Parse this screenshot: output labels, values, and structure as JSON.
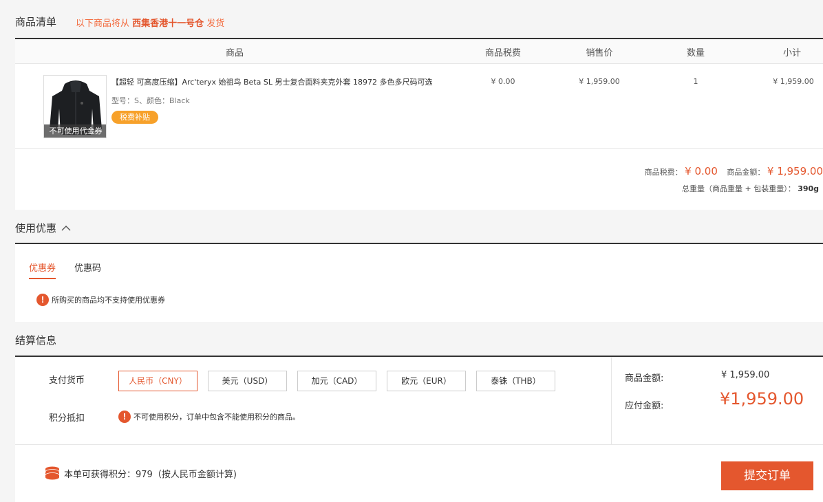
{
  "goods": {
    "title": "商品清单",
    "ship_prefix": "以下商品将从",
    "warehouse": "西集香港十一号仓",
    "ship_suffix": "发货",
    "headers": {
      "product": "商品",
      "tax": "商品税费",
      "price": "销售价",
      "qty": "数量",
      "subtotal": "小计"
    },
    "item": {
      "name": "【超轻 可高度压缩】Arc'teryx 始祖鸟 Beta SL 男士复合面料夹克外套 18972 多色多尺码可选",
      "spec": "型号：S、颜色：Black",
      "badge": "税费补贴",
      "image_label": "不可使用代金券",
      "tax": "¥ 0.00",
      "price": "¥ 1,959.00",
      "qty": "1",
      "subtotal": "¥ 1,959.00"
    },
    "summary": {
      "tax_label": "商品税费：",
      "tax_value": "¥ 0.00",
      "amount_label": "商品金额：",
      "amount_value": "¥ 1,959.00",
      "weight_label": "总重量（商品重量 + 包装重量）：",
      "weight_value": "390g"
    }
  },
  "discount": {
    "title": "使用优惠",
    "tabs": [
      "优惠券",
      "优惠码"
    ],
    "notice": "所购买的商品均不支持使用优惠券"
  },
  "checkout": {
    "title": "结算信息",
    "currency_label": "支付货币",
    "currencies": [
      "人民币（CNY）",
      "美元（USD）",
      "加元（CAD）",
      "欧元（EUR）",
      "泰铢（THB）"
    ],
    "points_label": "积分抵扣",
    "points_notice": "不可使用积分，订单中包含不能使用积分的商品。",
    "goods_amount_label": "商品金额:",
    "goods_amount_value": "¥ 1,959.00",
    "payable_label": "应付金额:",
    "payable_value": "¥1,959.00",
    "earn_points": "本单可获得积分：979（按人民币金额计算)",
    "submit": "提交订单"
  },
  "colors": {
    "accent": "#e4572e",
    "badge": "#f7a12a"
  }
}
